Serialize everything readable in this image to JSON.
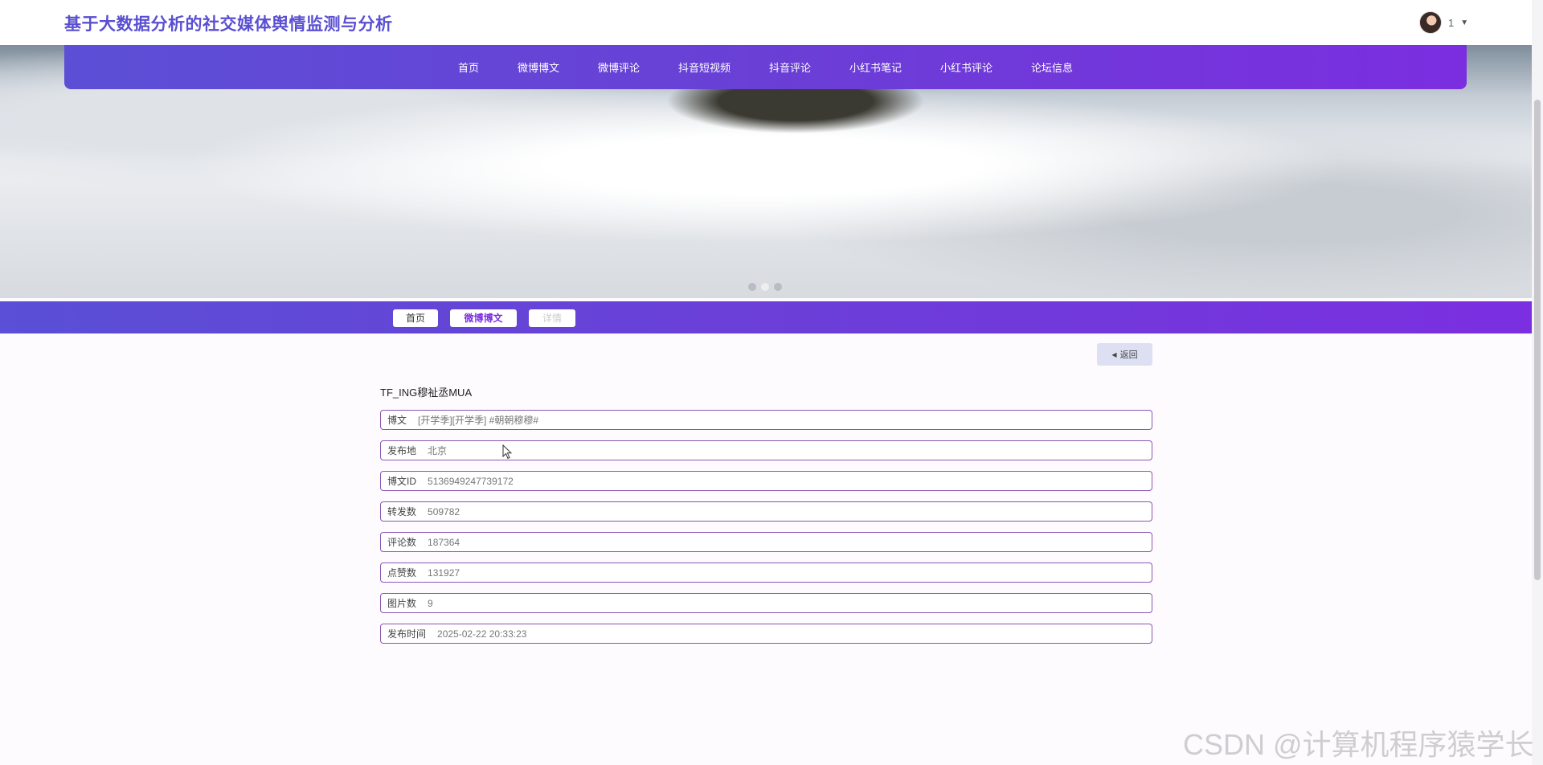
{
  "header": {
    "title": "基于大数据分析的社交媒体舆情监测与分析",
    "user_name": "1"
  },
  "nav": {
    "items": [
      "首页",
      "微博博文",
      "微博评论",
      "抖音短视频",
      "抖音评论",
      "小红书笔记",
      "小红书评论",
      "论坛信息"
    ]
  },
  "carousel": {
    "slides": 3,
    "active_index": 1
  },
  "breadcrumb": {
    "home": "首页",
    "category": "微博博文",
    "current": "详情"
  },
  "actions": {
    "back_label": "返回"
  },
  "detail": {
    "title": "TF_ING穆祉丞MUA",
    "fields": [
      {
        "label": "博文",
        "value": "[开学季][开学季] #朝朝穆穆#"
      },
      {
        "label": "发布地",
        "value": "北京"
      },
      {
        "label": "博文ID",
        "value": "5136949247739172"
      },
      {
        "label": "转发数",
        "value": "509782"
      },
      {
        "label": "评论数",
        "value": "187364"
      },
      {
        "label": "点赞数",
        "value": "131927"
      },
      {
        "label": "图片数",
        "value": "9"
      },
      {
        "label": "发布时间",
        "value": "2025-02-22 20:33:23"
      }
    ]
  },
  "watermark": "CSDN @计算机程序猿学长",
  "colors": {
    "brand": "#5a4fd3",
    "nav_gradient_start": "#5c4fd6",
    "nav_gradient_end": "#7b2ee0",
    "field_border": "#8c56b3"
  }
}
